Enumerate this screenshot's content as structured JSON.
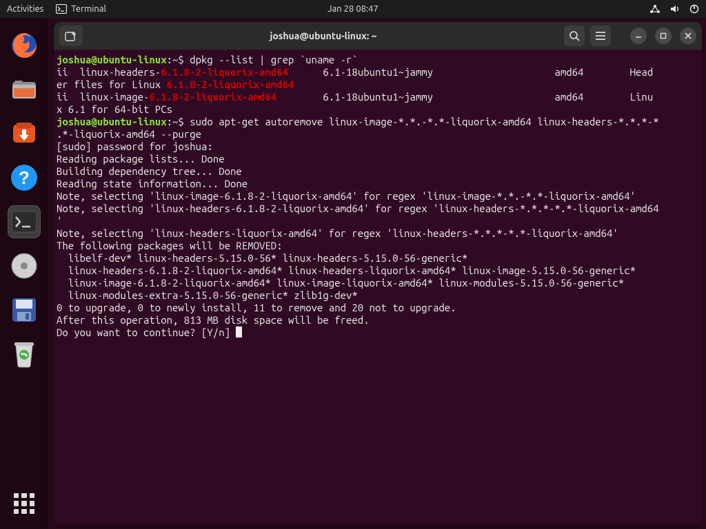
{
  "topbar": {
    "activities": "Activities",
    "app_name": "Terminal",
    "clock": "Jan 28  08:47"
  },
  "dock": {
    "items": [
      {
        "name": "firefox"
      },
      {
        "name": "files"
      },
      {
        "name": "software"
      },
      {
        "name": "help"
      },
      {
        "name": "terminal",
        "active": true
      },
      {
        "name": "disks"
      },
      {
        "name": "disk-usage"
      },
      {
        "name": "trash"
      }
    ]
  },
  "window": {
    "title": "joshua@ubuntu-linux: ~"
  },
  "prompt": {
    "user_host": "joshua@ubuntu-linux",
    "colon": ":",
    "path": "~",
    "dollar": "$"
  },
  "term": {
    "cmd1_pre": " dpkg --list | grep `uname -r`",
    "l1a": "ii  linux-headers-",
    "l1b": "6.1.8-2-liquorix-amd64",
    "l1c": "      6.1-18ubuntu1~jammy                     amd64        Head",
    "l2a": "er files for Linux ",
    "l2b": "6.1.8-2-liquorix-amd64",
    "l3a": "ii  linux-image-",
    "l3b": "6.1.8-2-liquorix-amd64",
    "l3c": "        6.1-18ubuntu1~jammy                     amd64        Linu",
    "l4": "x 6.1 for 64-bit PCs",
    "cmd2_pre": " sudo apt-get autoremove linux-image-*.*.-*.*-liquorix-amd64 linux-headers-*.*.*-*",
    "cmd2_line2": ".*-liquorix-amd64 --purge",
    "o0": "[sudo] password for joshua: ",
    "o1": "Reading package lists... Done",
    "o2": "Building dependency tree... Done",
    "o3": "Reading state information... Done",
    "o4": "Note, selecting 'linux-image-6.1.8-2-liquorix-amd64' for regex 'linux-image-*.*.-*.*-liquorix-amd64'",
    "o5": "Note, selecting 'linux-headers-6.1.8-2-liquorix-amd64' for regex 'linux-headers-*.*.*-*.*-liquorix-amd64",
    "o5b": "'",
    "o6": "Note, selecting 'linux-headers-liquorix-amd64' for regex 'linux-headers-*.*.*-*.*-liquorix-amd64'",
    "o7": "The following packages will be REMOVED:",
    "o8": "  libelf-dev* linux-headers-5.15.0-56* linux-headers-5.15.0-56-generic*",
    "o9": "  linux-headers-6.1.8-2-liquorix-amd64* linux-headers-liquorix-amd64* linux-image-5.15.0-56-generic*",
    "o10": "  linux-image-6.1.8-2-liquorix-amd64* linux-image-liquorix-amd64* linux-modules-5.15.0-56-generic*",
    "o11": "  linux-modules-extra-5.15.0-56-generic* zlib1g-dev*",
    "o12": "0 to upgrade, 0 to newly install, 11 to remove and 20 not to upgrade.",
    "o13": "After this operation, 813 MB disk space will be freed.",
    "o14": "Do you want to continue? [Y/n] "
  }
}
